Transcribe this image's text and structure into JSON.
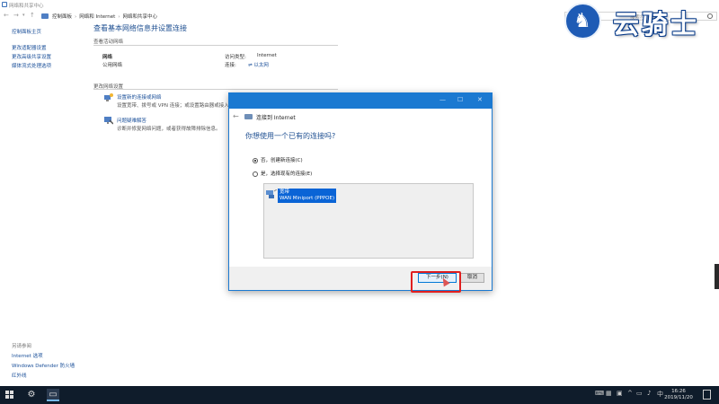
{
  "window": {
    "title": "网络和共享中心",
    "breadcrumbs": [
      "控制面板",
      "网络和 Internet",
      "网络和共享中心"
    ],
    "search_placeholder": "搜索控制面板"
  },
  "sidebar": {
    "items": [
      {
        "label": "控制面板主页"
      },
      {
        "label": "更改适配器设置"
      },
      {
        "label": "更改高级共享设置"
      },
      {
        "label": "媒体流式处理选项"
      }
    ],
    "see_also_heading": "另请参阅",
    "see_also": [
      {
        "label": "Internet 选项"
      },
      {
        "label": "Windows Defender 防火墙"
      },
      {
        "label": "红外线"
      }
    ]
  },
  "main": {
    "heading": "查看基本网络信息并设置连接",
    "active_networks_label": "查看活动网络",
    "network_name": "网络",
    "network_type": "公用网络",
    "access_type_label": "访问类型:",
    "access_type_value": "Internet",
    "connections_label": "连接:",
    "connections_value": "以太网",
    "change_settings_label": "更改网络设置",
    "items": [
      {
        "title": "设置新的连接或网络",
        "desc": "设置宽带、拨号或 VPN 连接；或设置路由器或接入点。"
      },
      {
        "title": "问题疑难解答",
        "desc": "诊断并修复网络问题，或者获得故障排除信息。"
      }
    ]
  },
  "logo": {
    "text": "云骑士"
  },
  "dialog": {
    "title": "连接到 Internet",
    "question": "你想使用一个已有的连接吗?",
    "options": [
      {
        "label": "否，创建新连接(C)",
        "selected": true
      },
      {
        "label": "是，选择现有的连接(E)",
        "selected": false
      }
    ],
    "connection": {
      "line1": "宽带",
      "line2": "WAN Miniport (PPPOE)"
    },
    "next_label": "下一步(N)",
    "cancel_label": "取消"
  },
  "taskbar": {
    "time": "16:26",
    "date": "2019/11/20",
    "ime": "中"
  },
  "colors": {
    "accent": "#1b79d1",
    "link": "#1a4f99",
    "highlight": "#e01f1f",
    "taskbar": "#0f1c2b"
  }
}
